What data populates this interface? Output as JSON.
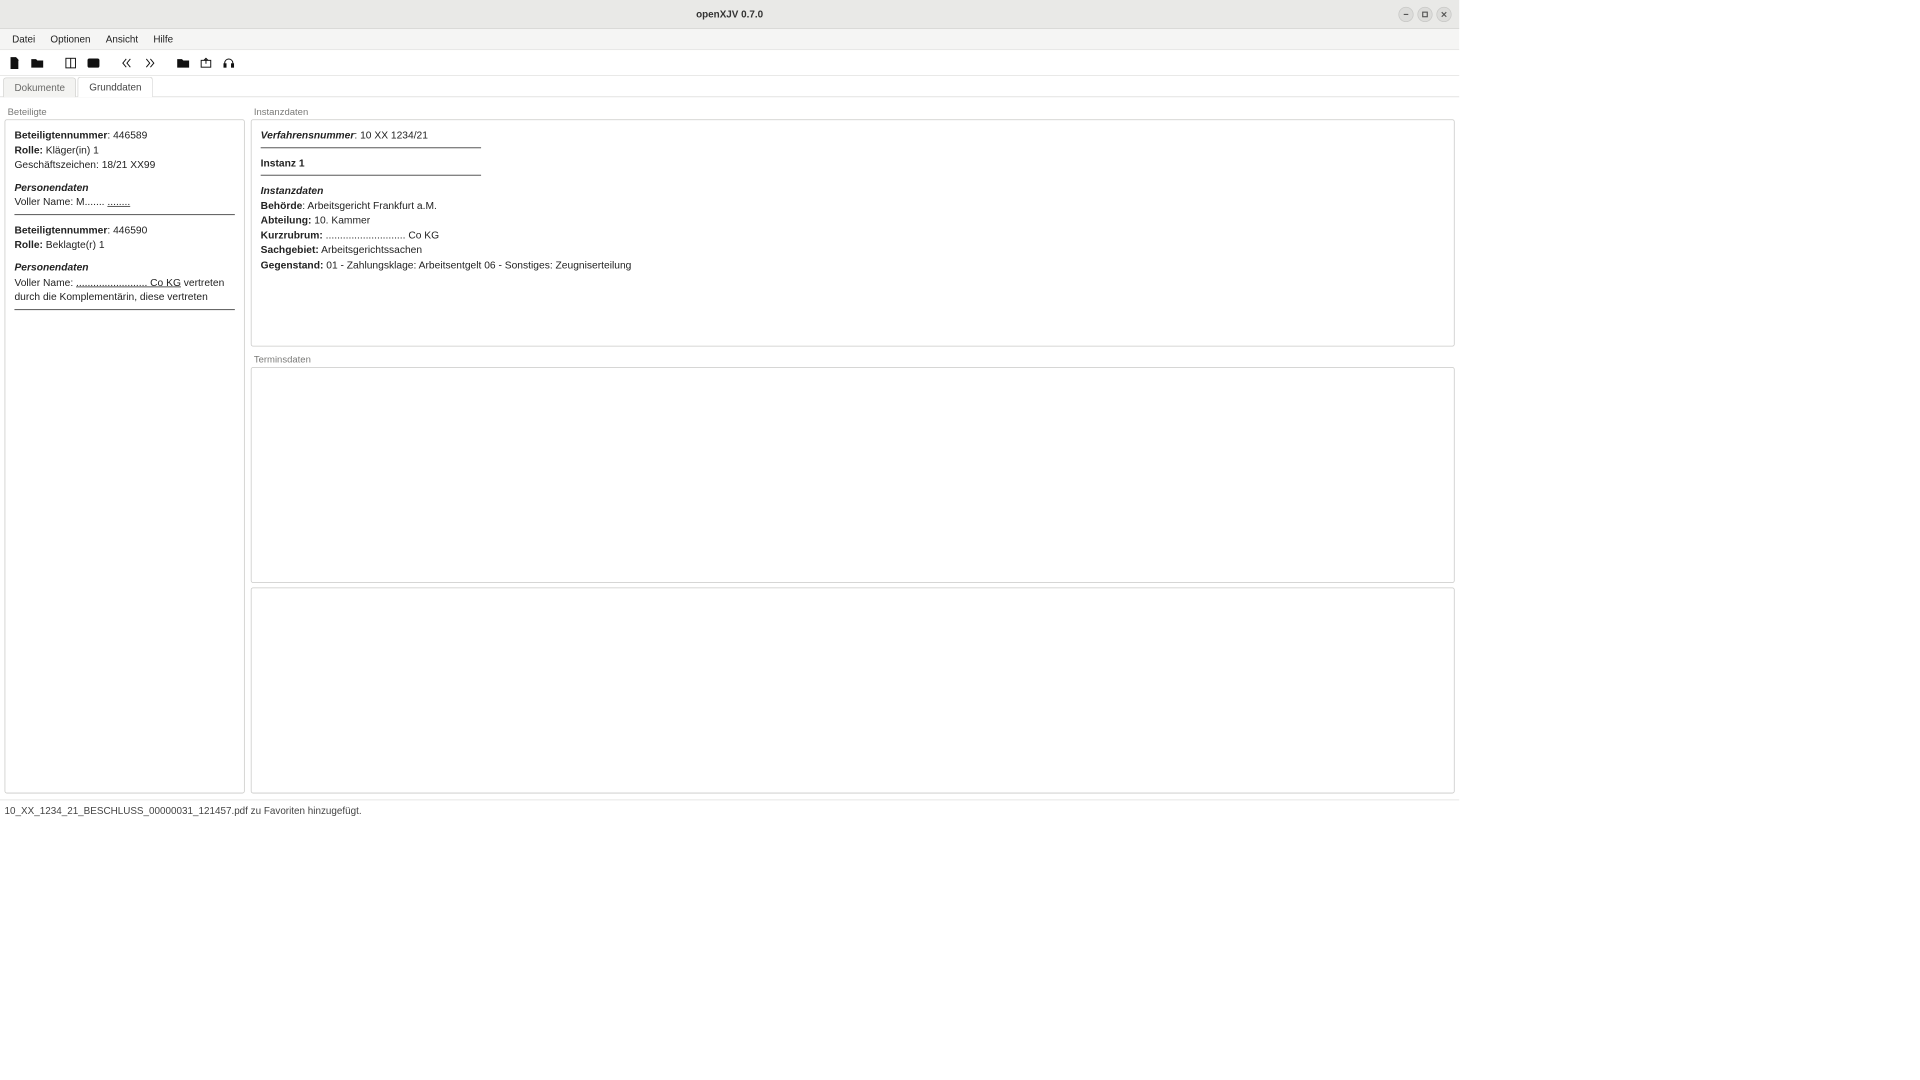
{
  "title": "openXJV 0.7.0",
  "menu": {
    "file": "Datei",
    "options": "Optionen",
    "view": "Ansicht",
    "help": "Hilfe"
  },
  "tabs": {
    "documents": "Dokumente",
    "basicdata": "Grunddaten"
  },
  "groups": {
    "participants": "Beteiligte",
    "instancedata": "Instanzdaten",
    "appointments": "Terminsdaten"
  },
  "participants": {
    "p1": {
      "num_label": "Beteiligtennummer",
      "num": ": 446589",
      "role_label": "Rolle:",
      "role": " Kläger(in) 1",
      "gz": "Geschäftszeichen: 18/21 XX99",
      "person_heading": "Personendaten",
      "fullname_label": "Voller Name: ",
      "fullname_pre": "M....... ",
      "fullname_uline": "........"
    },
    "p2": {
      "num_label": "Beteiligtennummer",
      "num": ": 446590",
      "role_label": "Rolle:",
      "role": " Beklagte(r) 1",
      "person_heading": "Personendaten",
      "fullname_label": "Voller Name: ",
      "fullname_uline": "......................... Co KG",
      "fullname_post": " vertreten durch die Komplementärin, diese vertreten"
    }
  },
  "instance": {
    "procnum_label": "Verfahrensnummer",
    "procnum": ": 10 XX 1234/21",
    "inst_heading": "Instanz 1",
    "data_heading": "Instanzdaten",
    "behorde_label": "Behörde",
    "behorde": ": Arbeitsgericht Frankfurt a.M.",
    "abteilung_label": "Abteilung:",
    "abteilung": " 10. Kammer",
    "kurz_label": "Kurzrubrum:",
    "kurz": " ............................ Co KG",
    "sach_label": "Sachgebiet:",
    "sach": " Arbeitsgerichtssachen",
    "gegen_label": "Gegenstand:",
    "gegen": " 01 - Zahlungsklage: Arbeitsentgelt 06 - Sonstiges: Zeugniserteilung"
  },
  "statusbar": "10_XX_1234_21_BESCHLUSS_00000031_121457.pdf zu Favoriten hinzugefügt."
}
